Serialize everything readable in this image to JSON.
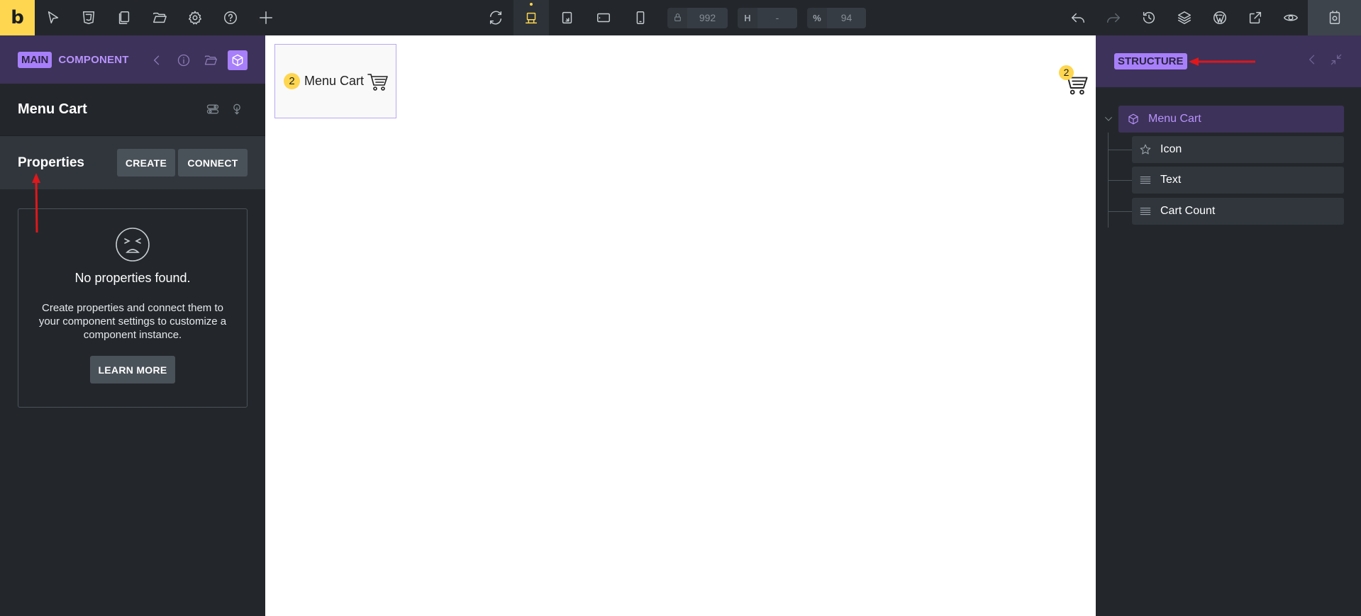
{
  "topbar": {
    "logo": "b",
    "width_label": "",
    "width_value": "992",
    "height_label": "H",
    "height_value": "-",
    "zoom_label": "%",
    "zoom_value": "94"
  },
  "left_panel": {
    "tag_main": "MAIN",
    "tag_component": "COMPONENT",
    "component_name": "Menu Cart",
    "properties_title": "Properties",
    "create_label": "CREATE",
    "connect_label": "CONNECT",
    "empty_title": "No properties found.",
    "empty_desc": "Create properties and connect them to your component settings to customize a component instance.",
    "learn_more_label": "LEARN MORE"
  },
  "canvas": {
    "preview_badge": "2",
    "preview_text": "Menu Cart",
    "cart_badge": "2"
  },
  "right_panel": {
    "tag_structure": "STRUCTURE",
    "tree": {
      "root": "Menu Cart",
      "children": [
        "Icon",
        "Text",
        "Cart Count"
      ]
    }
  },
  "colors": {
    "accent_yellow": "#ffd64f",
    "accent_purple": "#a77ffa",
    "panel_bg": "#23272b",
    "annotation_red": "#e0171b"
  }
}
